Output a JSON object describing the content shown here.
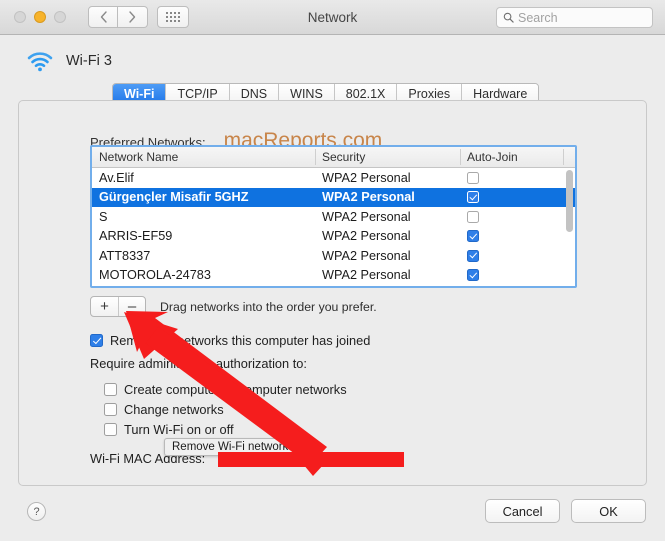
{
  "window": {
    "title": "Network",
    "traffic_lights": [
      "close",
      "minimize",
      "zoom"
    ],
    "nav_back": "‹",
    "nav_forward": "›",
    "grid_button": "show-all"
  },
  "search": {
    "placeholder": "Search",
    "value": ""
  },
  "header": {
    "device_name": "Wi-Fi 3"
  },
  "tabs": [
    {
      "label": "Wi-Fi",
      "active": true
    },
    {
      "label": "TCP/IP",
      "active": false
    },
    {
      "label": "DNS",
      "active": false
    },
    {
      "label": "WINS",
      "active": false
    },
    {
      "label": "802.1X",
      "active": false
    },
    {
      "label": "Proxies",
      "active": false
    },
    {
      "label": "Hardware",
      "active": false
    }
  ],
  "preferred": {
    "label": "Preferred Networks:",
    "watermark": "macReports.com",
    "columns": [
      "Network Name",
      "Security",
      "Auto-Join"
    ],
    "rows": [
      {
        "name": "Av.Elif",
        "security": "WPA2 Personal",
        "auto_join": false,
        "selected": false
      },
      {
        "name": "Gürgençler Misafir 5GHZ",
        "security": "WPA2 Personal",
        "auto_join": true,
        "selected": true
      },
      {
        "name": "S",
        "security": "WPA2 Personal",
        "auto_join": false,
        "selected": false
      },
      {
        "name": "ARRIS-EF59",
        "security": "WPA2 Personal",
        "auto_join": true,
        "selected": false
      },
      {
        "name": "ATT8337",
        "security": "WPA2 Personal",
        "auto_join": true,
        "selected": false
      },
      {
        "name": "MOTOROLA-24783",
        "security": "WPA2 Personal",
        "auto_join": true,
        "selected": false
      }
    ]
  },
  "list_controls": {
    "add_label": "+",
    "remove_label": "–",
    "hint": "Drag networks into the order you prefer."
  },
  "tooltip": {
    "text": "Remove Wi-Fi network"
  },
  "options": {
    "remember": {
      "label": "Remember networks this computer has joined",
      "checked": true
    },
    "require_label": "Require administrator authorization to:",
    "create": {
      "label": "Create computer-to-computer networks",
      "checked": false
    },
    "change": {
      "label": "Change networks",
      "checked": false
    },
    "toggle": {
      "label": "Turn Wi-Fi on or off",
      "checked": false
    }
  },
  "mac": {
    "label": "Wi-Fi MAC Address:",
    "value": ""
  },
  "footer": {
    "help_label": "?",
    "cancel_label": "Cancel",
    "ok_label": "OK"
  },
  "colors": {
    "accent_blue": "#0f72e0",
    "tab_active_blue": "#1c73e8",
    "watermark_orange": "#c8854a",
    "annotation_red": "#f51d1d",
    "wifi_icon_blue": "#2d9bf0"
  }
}
